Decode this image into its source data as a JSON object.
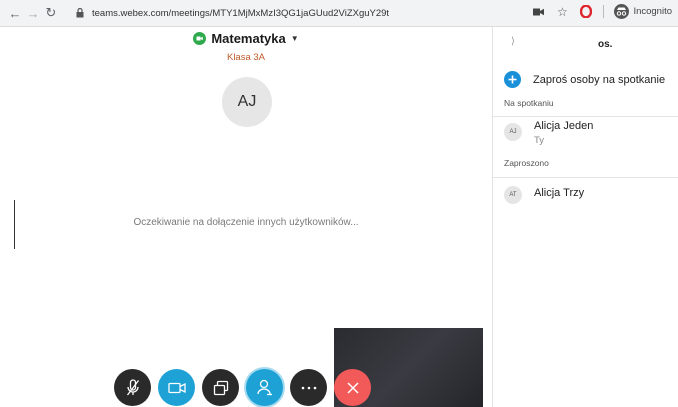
{
  "browser": {
    "url": "teams.webex.com/meetings/MTY1MjMxMzI3QG1jaGUud2ViZXguY29t",
    "incognito_label": "Incognito"
  },
  "meeting": {
    "title": "Matematyka",
    "subtitle": "Klasa 3A",
    "avatar_initials": "AJ",
    "waiting_text": "Oczekiwanie na dołączenie innych użytkowników..."
  },
  "controls": [
    {
      "name": "mute",
      "icon": "mic-off-icon"
    },
    {
      "name": "video",
      "icon": "video-icon"
    },
    {
      "name": "share",
      "icon": "share-screen-icon"
    },
    {
      "name": "participants",
      "icon": "participants-icon"
    },
    {
      "name": "more",
      "icon": "more-icon"
    },
    {
      "name": "leave",
      "icon": "close-icon"
    }
  ],
  "panel": {
    "title": "os.",
    "invite_label": "Zaproś osoby na spotkanie",
    "in_meeting_label": "Na spotkaniu",
    "invited_label": "Zaproszono",
    "in_meeting": [
      {
        "initials": "AJ",
        "name": "Alicja Jeden",
        "sub": "Ty"
      }
    ],
    "invited": [
      {
        "initials": "AT",
        "name": "Alicja Trzy"
      }
    ]
  },
  "colors": {
    "accent_blue": "#1ea2d6",
    "leave_red": "#f25a5a",
    "meeting_green": "#2fa94d",
    "subtitle_orange": "#c05a2a"
  }
}
